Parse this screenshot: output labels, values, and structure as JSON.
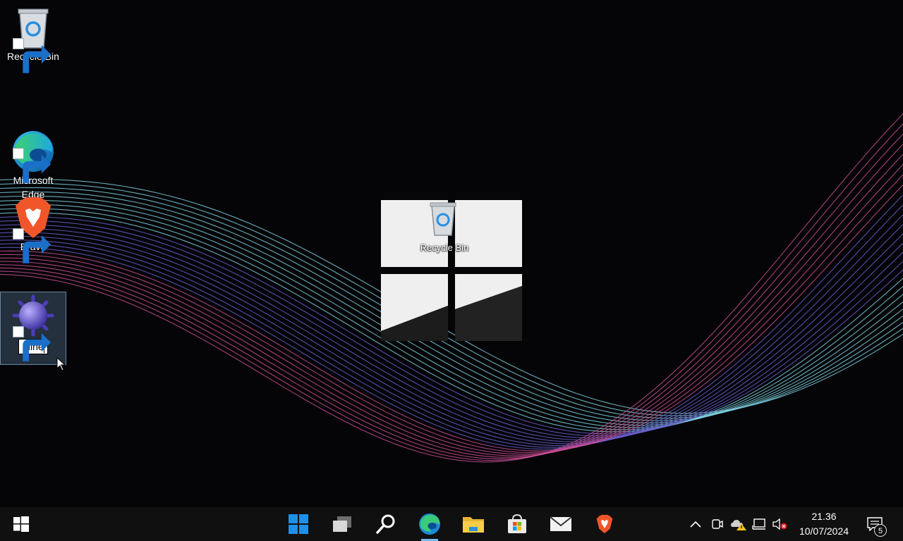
{
  "desktop": {
    "icons": [
      {
        "label": "Recycle Bin",
        "icon": "recycle-bin-icon"
      },
      {
        "label": "Microsoft\nEdge",
        "icon": "edge-icon"
      },
      {
        "label": "Brave",
        "icon": "brave-icon"
      },
      {
        "label": "Mine",
        "icon": "minesweeper-icon",
        "state": "renaming"
      }
    ],
    "center_overlay_label": "Recycle Bin",
    "wallpaper": "windows-logo-with-wave-lines"
  },
  "taskbar": {
    "start": "windows-start-icon",
    "apps": [
      {
        "name": "task-view-icon"
      },
      {
        "name": "search-icon"
      },
      {
        "name": "edge-icon",
        "active": true
      },
      {
        "name": "file-explorer-icon"
      },
      {
        "name": "microsoft-store-icon"
      },
      {
        "name": "mail-icon"
      },
      {
        "name": "brave-icon"
      }
    ],
    "center_logo": "windows-11-logo-icon",
    "tray": {
      "chevron": "show-hidden-icons",
      "icons": [
        "meet-now-icon",
        "weather-warning-icon",
        "network-icon",
        "volume-muted-icon"
      ],
      "time": "21.36",
      "date": "10/07/2024",
      "notification_count": "5"
    }
  },
  "colors": {
    "taskbar_bg": "#101010",
    "accent": "#76b9ed",
    "wave_cyan": "#7fd6e6",
    "wave_pink": "#d0509a",
    "wave_purple": "#6a5fd0"
  }
}
